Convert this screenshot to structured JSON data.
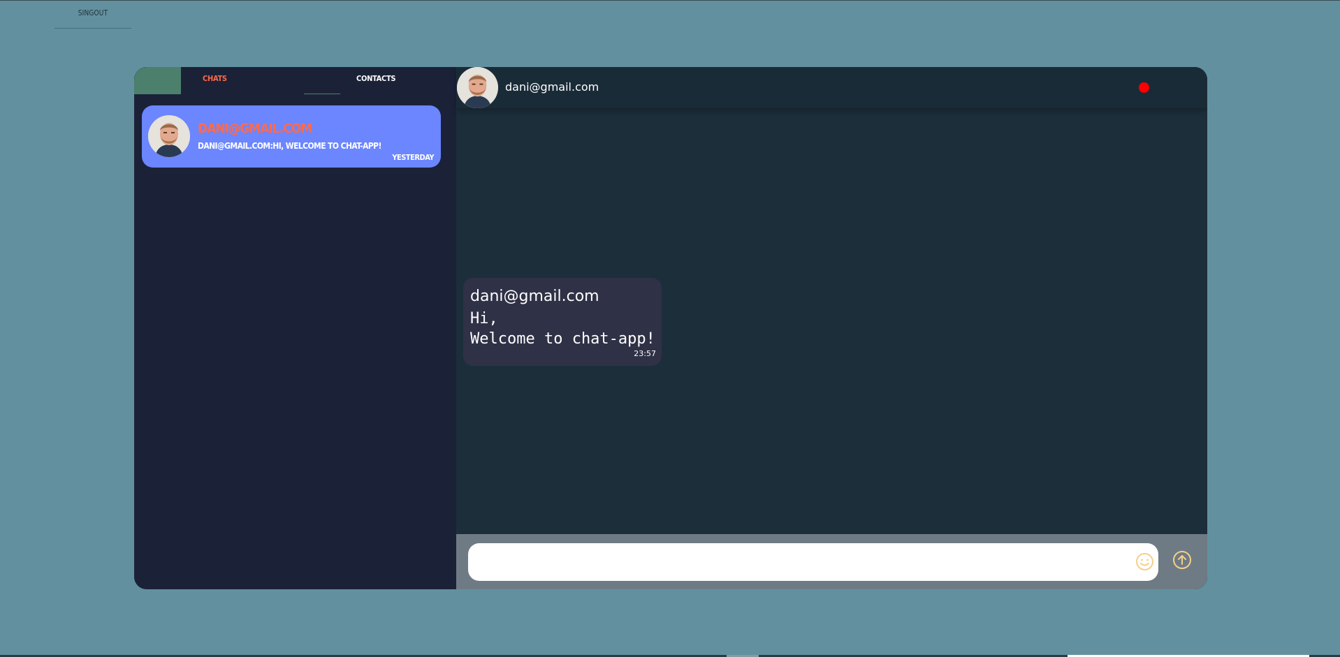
{
  "top": {
    "signout_label": "SINGOUT"
  },
  "sidebar": {
    "tabs": [
      {
        "label": "CHATS",
        "active": true
      },
      {
        "label": "CONTACTS",
        "active": false
      }
    ],
    "chats": [
      {
        "name": "dani@gmail.com",
        "preview": "dani@gmail.com:Hi, Welcome to chat-app!",
        "time": "Yesterday"
      }
    ]
  },
  "conversation": {
    "header": {
      "name": "dani@gmail.com",
      "status_color": "#ff0000"
    },
    "messages": [
      {
        "sender": "dani@gmail.com",
        "text": "Hi,\nWelcome to chat-app!",
        "time": "23:57"
      }
    ],
    "composer": {
      "placeholder": "",
      "emoji_icon": "smiley-icon",
      "send_icon": "arrow-up-circle-icon"
    }
  },
  "colors": {
    "page_bg": "#62909f",
    "sidebar_bg": "#1b2238",
    "conversation_bg": "#1c2e3a",
    "chat_item_bg": "#6b86ff",
    "accent": "#ff6a4a",
    "message_bg": "#2f3146",
    "composer_bg": "#6f7b84",
    "icon_color": "#f4d08a"
  }
}
